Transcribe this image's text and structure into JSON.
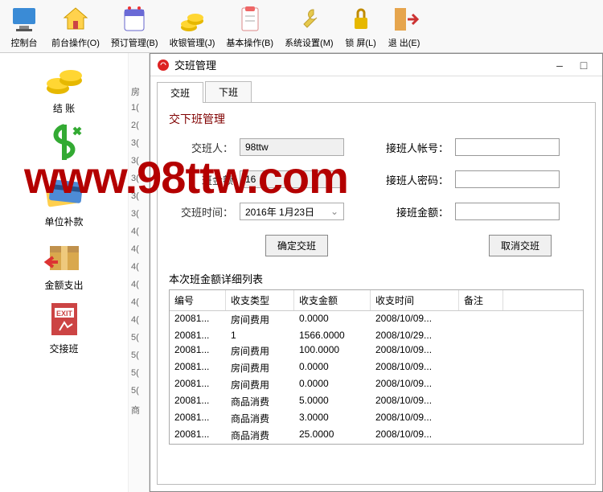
{
  "toolbar": [
    {
      "label": "控制台",
      "icon": "monitor"
    },
    {
      "label": "前台操作(O)",
      "icon": "home"
    },
    {
      "label": "预订管理(B)",
      "icon": "calendar"
    },
    {
      "label": "收银管理(J)",
      "icon": "cashier"
    },
    {
      "label": "基本操作(B)",
      "icon": "clipboard"
    },
    {
      "label": "系统设置(M)",
      "icon": "wrench"
    },
    {
      "label": "锁 屏(L)",
      "icon": "lock"
    },
    {
      "label": "退 出(E)",
      "icon": "exit"
    }
  ],
  "sidebar": [
    {
      "label": "结 账",
      "icon": "coins"
    },
    {
      "label": "",
      "icon": "dollar"
    },
    {
      "label": "单位补款",
      "icon": "card"
    },
    {
      "label": "金额支出",
      "icon": "box"
    },
    {
      "label": "交接班",
      "icon": "exitdoor"
    }
  ],
  "ruler": [
    "房",
    "1(",
    "2(",
    "3(",
    "3(",
    "3(",
    "3(",
    "3(",
    "4(",
    "4(",
    "4(",
    "4(",
    "4(",
    "4(",
    "5(",
    "5(",
    "5(",
    "5(",
    "商"
  ],
  "dialog": {
    "title": "交班管理",
    "tabs": [
      "交班",
      "下班"
    ],
    "active_tab": 0,
    "panel_title": "交下班管理",
    "form": {
      "shift_person_label": "交班人：",
      "shift_person_value": "98ttw",
      "recv_account_label": "接班人帐号：",
      "shift_amount_label": "班金额",
      "shift_amount_value": "16",
      "recv_password_label": "接班人密码：",
      "shift_time_label": "交班时间：",
      "shift_time_value": "2016年 1月23日",
      "recv_amount_label": "接班金额："
    },
    "confirm_label": "确定交班",
    "cancel_label": "取消交班",
    "table_title": "本次班金额详细列表",
    "table_headers": [
      "编号",
      "收支类型",
      "收支金额",
      "收支时间",
      "备注"
    ],
    "table_rows": [
      [
        "20081...",
        "房间费用",
        "0.0000",
        "2008/10/09...",
        ""
      ],
      [
        "20081...",
        "1",
        "1566.0000",
        "2008/10/29...",
        ""
      ],
      [
        "20081...",
        "房间费用",
        "100.0000",
        "2008/10/09...",
        ""
      ],
      [
        "20081...",
        "房间费用",
        "0.0000",
        "2008/10/09...",
        ""
      ],
      [
        "20081...",
        "房间费用",
        "0.0000",
        "2008/10/09...",
        ""
      ],
      [
        "20081...",
        "商品消费",
        "5.0000",
        "2008/10/09...",
        ""
      ],
      [
        "20081...",
        "商品消费",
        "3.0000",
        "2008/10/09...",
        ""
      ],
      [
        "20081...",
        "商品消费",
        "25.0000",
        "2008/10/09...",
        ""
      ]
    ]
  },
  "watermark": "www.98ttw.com"
}
